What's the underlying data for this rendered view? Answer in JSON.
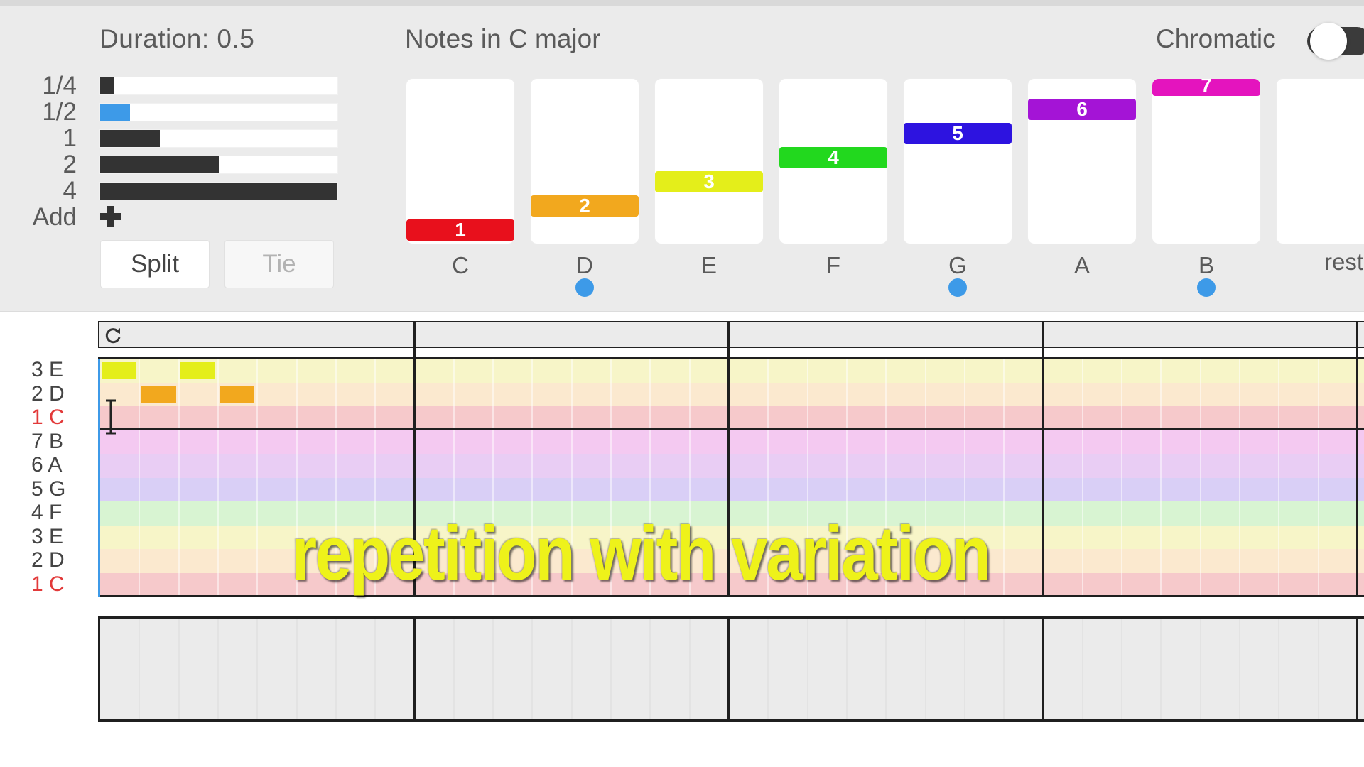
{
  "duration_panel": {
    "title": "Duration: 0.5",
    "rows": [
      {
        "label": "1/4",
        "fill": 0.06,
        "selected": false
      },
      {
        "label": "1/2",
        "fill": 0.125,
        "selected": true
      },
      {
        "label": "1",
        "fill": 0.25,
        "selected": false
      },
      {
        "label": "2",
        "fill": 0.5,
        "selected": false
      },
      {
        "label": "4",
        "fill": 1.0,
        "selected": false
      }
    ],
    "add_label": "Add",
    "split_label": "Split",
    "tie_label": "Tie"
  },
  "notes_panel": {
    "title": "Notes in C major",
    "chromatic_label": "Chromatic",
    "chromatic_on": false,
    "notes": [
      {
        "name": "C",
        "degree": "1",
        "color": "#e8101c",
        "level": 1,
        "dot": false
      },
      {
        "name": "D",
        "degree": "2",
        "color": "#f2a81e",
        "level": 2,
        "dot": true
      },
      {
        "name": "E",
        "degree": "3",
        "color": "#e4ee1a",
        "level": 3,
        "dot": false
      },
      {
        "name": "F",
        "degree": "4",
        "color": "#22d81e",
        "level": 4,
        "dot": false
      },
      {
        "name": "G",
        "degree": "5",
        "color": "#2d13e0",
        "level": 5,
        "dot": true
      },
      {
        "name": "A",
        "degree": "6",
        "color": "#a414d6",
        "level": 6,
        "dot": false
      },
      {
        "name": "B",
        "degree": "7",
        "color": "#e414be",
        "level": 7,
        "dot": true
      },
      {
        "name": "rest",
        "degree": "",
        "color": "",
        "level": 0,
        "dot": false
      }
    ]
  },
  "grid": {
    "pitch_rows": [
      {
        "label": "3 E",
        "color": "#f7f5c8",
        "red": false
      },
      {
        "label": "2 D",
        "color": "#fbe9cf",
        "red": false
      },
      {
        "label": "1 C",
        "color": "#f6c9cb",
        "red": true
      },
      {
        "label": "7 B",
        "color": "#f4c9f1",
        "red": false
      },
      {
        "label": "6 A",
        "color": "#e9cdf4",
        "red": false
      },
      {
        "label": "5 G",
        "color": "#d9cff6",
        "red": false
      },
      {
        "label": "4 F",
        "color": "#d8f4d2",
        "red": false
      },
      {
        "label": "3 E",
        "color": "#f7f5c8",
        "red": false
      },
      {
        "label": "2 D",
        "color": "#fbe9cf",
        "red": false
      },
      {
        "label": "1 C",
        "color": "#f6c9cb",
        "red": true
      }
    ],
    "measures": 4,
    "beats_per_measure": 8,
    "placed_notes": [
      {
        "row": 0,
        "beat": 0,
        "length": 1,
        "color": "#e4ee1a"
      },
      {
        "row": 1,
        "beat": 1,
        "length": 1,
        "color": "#f2a81e"
      },
      {
        "row": 0,
        "beat": 2,
        "length": 1,
        "color": "#e4ee1a"
      },
      {
        "row": 1,
        "beat": 3,
        "length": 1,
        "color": "#f2a81e"
      }
    ]
  },
  "caption": "repetition with variation"
}
